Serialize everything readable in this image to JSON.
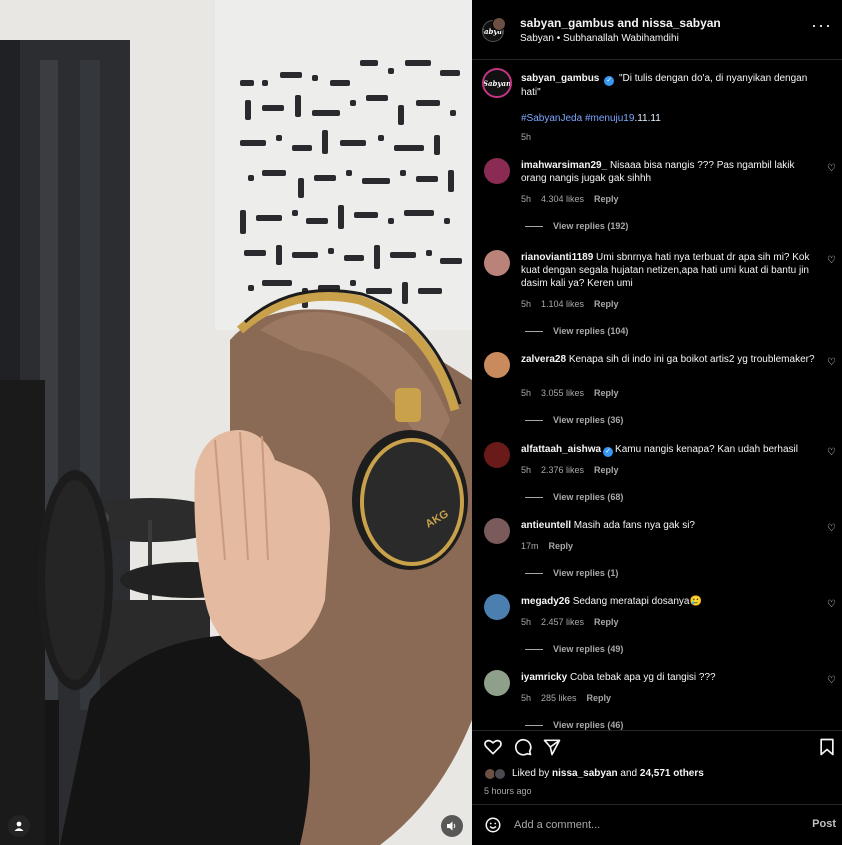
{
  "header": {
    "names": "sabyan_gambus and nissa_sabyan",
    "subtitle": "Sabyan • Subhanallah Wabihamdihi",
    "more_icon": "more-horizontal-icon",
    "brand_avatar_text": "Sabyan"
  },
  "caption": {
    "username": "sabyan_gambus",
    "text": "\"Di tulis dengan do'a, di nyanyikan dengan hati\"",
    "hashtags": "#SabyanJeda #menuju19",
    "hashtag_suffix": ".11.11",
    "time": "5h"
  },
  "comments": [
    {
      "username": "imahwarsiman29_",
      "text": "Nisaaa bisa nangis ??? Pas ngambil lakik orang nangis jugak gak sihhh",
      "time": "5h",
      "likes": "4.304 likes",
      "reply": "Reply",
      "view_replies": "View replies (192)",
      "avatar_color": "#8a2b53"
    },
    {
      "username": "rianovianti1189",
      "text": "Umi sbnrnya hati nya terbuat dr apa sih mi? Kok kuat dengan segala hujatan netizen,apa hati umi kuat di bantu jin dasim kali ya? Keren umi",
      "time": "5h",
      "likes": "1.104 likes",
      "reply": "Reply",
      "view_replies": "View replies (104)",
      "avatar_color": "#b9837a"
    },
    {
      "username": "zalvera28",
      "text": "Kenapa sih di indo ini ga boikot artis2 yg troublemaker?",
      "time": "5h",
      "likes": "3.055 likes",
      "reply": "Reply",
      "view_replies": "View replies (36)",
      "avatar_color": "#c98a5d"
    },
    {
      "username": "alfattaah_aishwa",
      "text": "Kamu nangis kenapa? Kan udah berhasil",
      "time": "5h",
      "likes": "2.376 likes",
      "reply": "Reply",
      "view_replies": "View replies (68)",
      "avatar_color": "#6b1a1a",
      "verified": true
    },
    {
      "username": "antieuntell",
      "text": "Masih ada fans nya gak si?",
      "time": "17m",
      "likes": "",
      "reply": "Reply",
      "view_replies": "View replies (1)",
      "avatar_color": "#7a5a5a"
    },
    {
      "username": "megady26",
      "text": "Sedang meratapi dosanya🥲",
      "time": "5h",
      "likes": "2.457 likes",
      "reply": "Reply",
      "view_replies": "View replies (49)",
      "avatar_color": "#4a7fb0"
    },
    {
      "username": "iyamricky",
      "text": "Coba tebak apa yg di tangisi ???",
      "time": "5h",
      "likes": "285 likes",
      "reply": "Reply",
      "view_replies": "View replies (46)",
      "avatar_color": "#8fa08a"
    }
  ],
  "actions": {
    "like_icon": "heart-icon",
    "comment_icon": "comment-icon",
    "share_icon": "share-icon",
    "save_icon": "bookmark-icon",
    "liked_by_prefix": "Liked by ",
    "liked_by_user": "nissa_sabyan",
    "liked_by_middle": " and ",
    "liked_by_count": "24,571 others",
    "post_time": "5 hours ago"
  },
  "comment_box": {
    "placeholder": "Add a comment...",
    "post_label": "Post",
    "emoji_icon": "emoji-icon"
  },
  "video": {
    "headphone_brand": "AKG",
    "user_tag_icon": "user-icon",
    "mute_icon": "speaker-icon"
  }
}
